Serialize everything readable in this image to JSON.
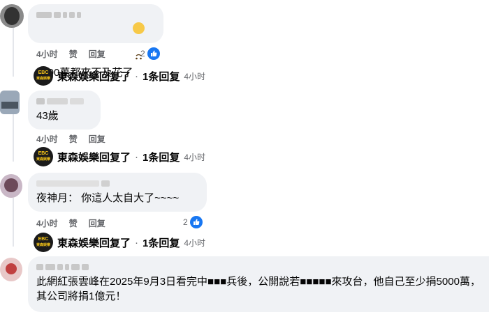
{
  "comments": [
    {
      "text": "5000萬都來不及花了",
      "emoji": "upside-down-face",
      "time": "4小时",
      "like": "赞",
      "reply": "回复",
      "reaction_count": "2",
      "replies": {
        "name": "東森娛樂回复了",
        "sep": "·",
        "count": "1条回复",
        "time": "4小时"
      }
    },
    {
      "text": "43歲",
      "time": "4小时",
      "like": "赞",
      "reply": "回复",
      "replies": {
        "name": "東森娛樂回复了",
        "sep": "·",
        "count": "1条回复",
        "time": "4小时"
      }
    },
    {
      "text": "夜神月： 你這人太自大了~~~~",
      "time": "4小时",
      "like": "赞",
      "reply": "回复",
      "reaction_count": "2",
      "replies": {
        "name": "東森娛樂回复了",
        "sep": "·",
        "count": "1条回复",
        "time": "4小时"
      }
    },
    {
      "text": "此網紅張雲峰在2025年9月3日看完中■■■兵後，公開說若■■■■■來攻台，他自己至少捐5000萬，其公司將捐1億元！"
    }
  ],
  "page_avatar_text": "EBC",
  "page_avatar_sub": "東森娛樂",
  "colors": {
    "like_blue": "#1877f2",
    "bubble_bg": "#f0f2f5",
    "meta_gray": "#65676b"
  }
}
